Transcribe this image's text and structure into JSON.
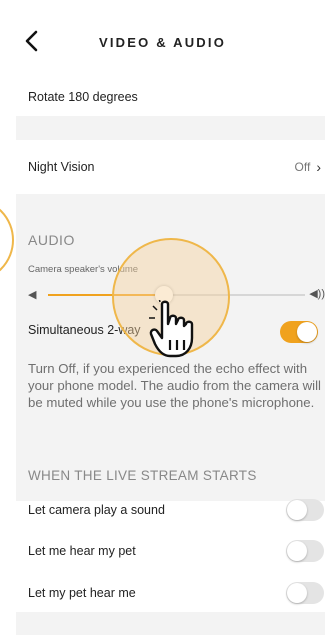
{
  "header": {
    "title": "VIDEO & AUDIO",
    "back_icon": "chevron-left-icon"
  },
  "settings": {
    "rotate_label": "Rotate 180 degrees",
    "night_vision_label": "Night Vision",
    "night_vision_value": "Off"
  },
  "audio": {
    "section_title": "AUDIO",
    "volume_label": "Camera speaker's volume",
    "volume_value": 0.45,
    "simultaneous_label": "Simultaneous 2-way",
    "simultaneous_on": true,
    "description": "Turn Off, if you experienced the echo effect with your phone model. The audio from the camera will be muted while you use the phone's microphone."
  },
  "live_stream": {
    "section_title": "WHEN THE LIVE STREAM STARTS",
    "items": [
      {
        "label": "Let camera play a sound",
        "on": false
      },
      {
        "label": "Let me hear my pet",
        "on": false
      },
      {
        "label": "Let my pet hear me",
        "on": false
      }
    ]
  },
  "colors": {
    "accent": "#f0a21e",
    "background": "#f3f3f3",
    "section_text": "#888888"
  }
}
